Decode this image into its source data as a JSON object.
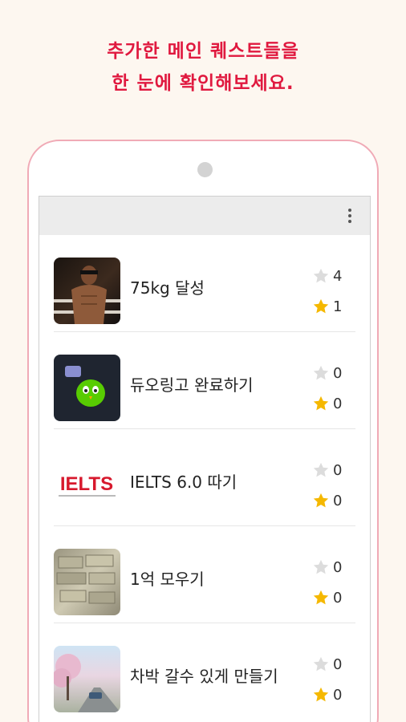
{
  "headline": {
    "line1": "추가한 메인 퀘스트들을",
    "line2": "한 눈에 확인해보세요."
  },
  "colors": {
    "accent": "#e0193f",
    "star_empty": "#dcdcdc",
    "star_filled": "#f5b800"
  },
  "appbar": {
    "menu_icon": "more-vert-icon"
  },
  "quests": [
    {
      "title": "75kg 달성",
      "empty_star_count": "4",
      "filled_star_count": "1",
      "thumb": "muscle-photo"
    },
    {
      "title": "듀오링고 완료하기",
      "empty_star_count": "0",
      "filled_star_count": "0",
      "thumb": "duolingo-owl"
    },
    {
      "title": "IELTS 6.0 따기",
      "empty_star_count": "0",
      "filled_star_count": "0",
      "thumb": "ielts-logo",
      "logo_text": "IELTS"
    },
    {
      "title": "1억 모우기",
      "empty_star_count": "0",
      "filled_star_count": "0",
      "thumb": "money-stack-photo"
    },
    {
      "title": "차박 갈수 있게 만들기",
      "empty_star_count": "0",
      "filled_star_count": "0",
      "thumb": "cherry-blossom-road-photo"
    }
  ]
}
